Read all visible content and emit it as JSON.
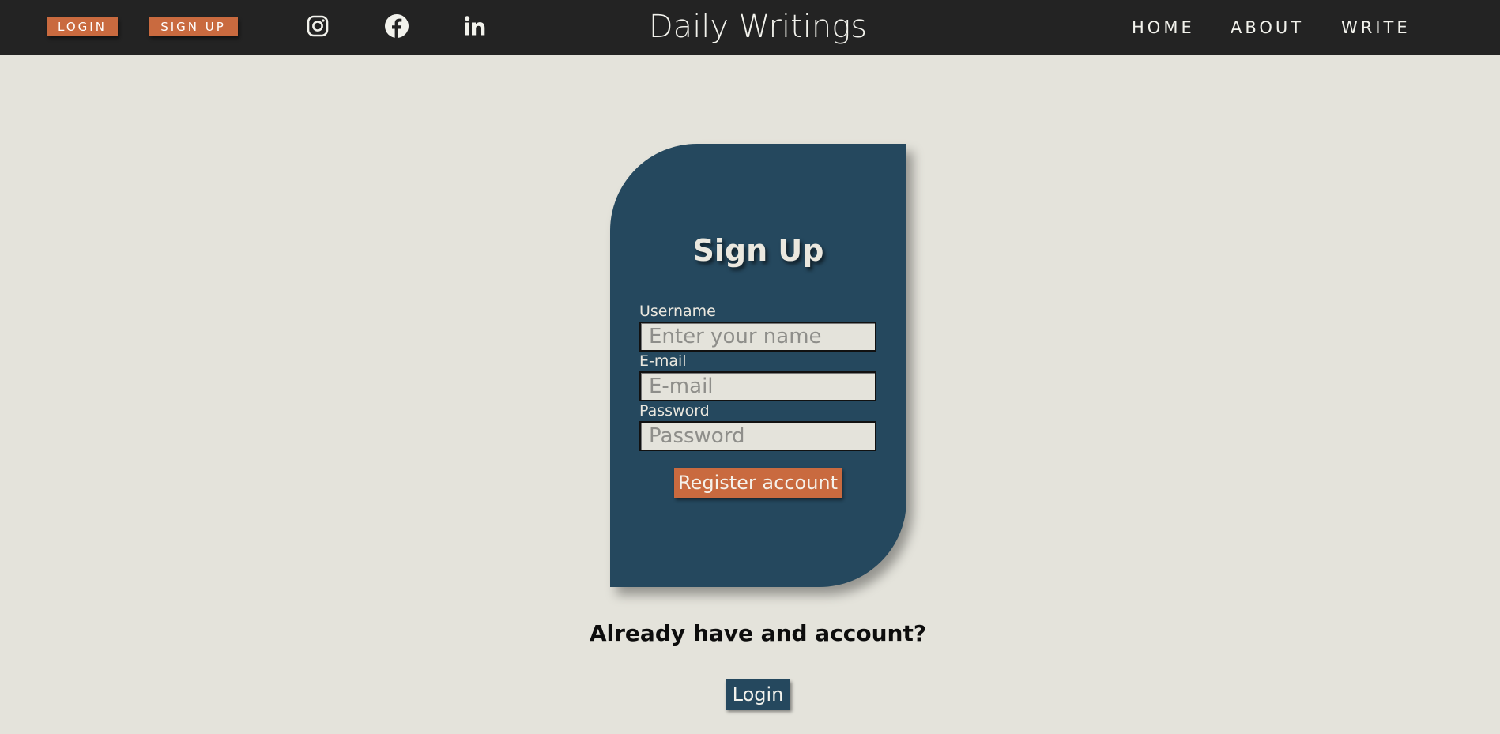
{
  "header": {
    "login_label": "LOGIN",
    "signup_label": "SIGN UP",
    "social": [
      {
        "icon": "instagram-icon"
      },
      {
        "icon": "facebook-icon"
      },
      {
        "icon": "linkedin-icon"
      }
    ],
    "site_title": "Daily Writings",
    "nav": [
      {
        "label": "HOME"
      },
      {
        "label": "ABOUT"
      },
      {
        "label": "WRITE"
      }
    ]
  },
  "signup_form": {
    "title": "Sign Up",
    "fields": [
      {
        "label": "Username",
        "placeholder": "Enter your name",
        "value": ""
      },
      {
        "label": "E-mail",
        "placeholder": "E-mail",
        "value": ""
      },
      {
        "label": "Password",
        "placeholder": "Password",
        "value": ""
      }
    ],
    "submit_label": "Register account"
  },
  "footer": {
    "prompt": "Already have and account?",
    "login_label": "Login"
  },
  "colors": {
    "topbar": "#232323",
    "background": "#e4e3db",
    "accent": "#c96a3f",
    "card": "#25485e"
  }
}
